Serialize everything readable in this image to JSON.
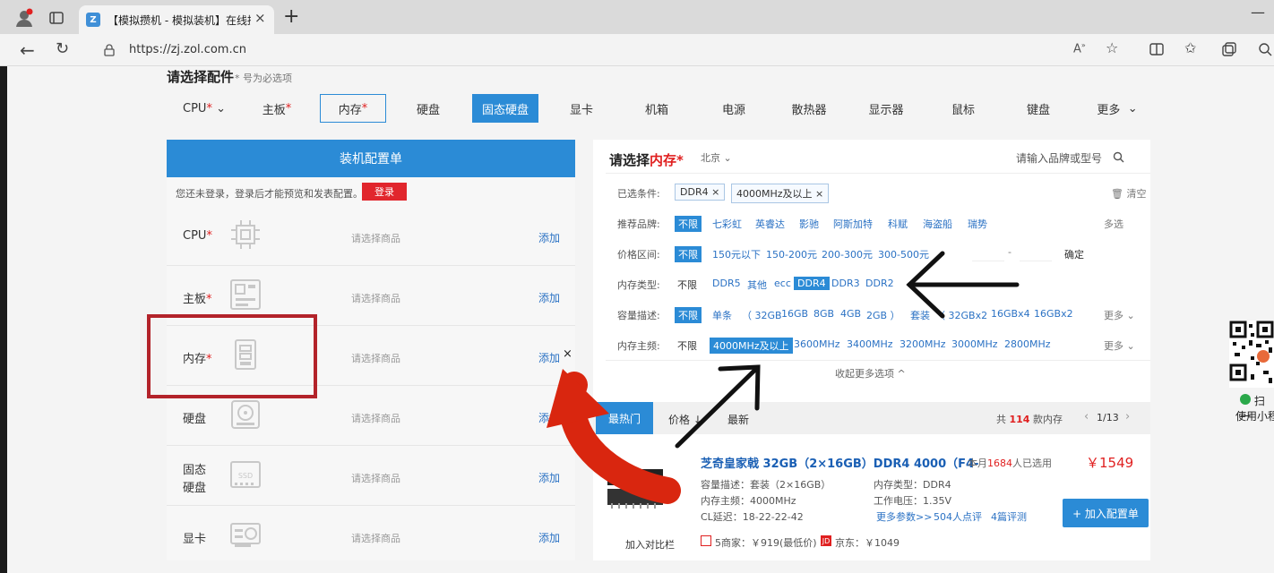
{
  "browser": {
    "tab_title": "【模拟攒机 - 模拟装机】在线攒",
    "tab_close": "×",
    "new_tab": "+",
    "url": "https://zj.zol.com.cn",
    "minimize": "—"
  },
  "header": {
    "title": "请选择配件",
    "required_note": "* 号为必选项"
  },
  "categories": [
    {
      "label": "CPU",
      "req": "*",
      "arrow": "⌄"
    },
    {
      "label": "主板",
      "req": "*"
    },
    {
      "label": "内存",
      "req": "*"
    },
    {
      "label": "硬盘"
    },
    {
      "label": "固态硬盘"
    },
    {
      "label": "显卡"
    },
    {
      "label": "机箱"
    },
    {
      "label": "电源"
    },
    {
      "label": "散热器"
    },
    {
      "label": "显示器"
    },
    {
      "label": "鼠标"
    },
    {
      "label": "键盘"
    },
    {
      "label": "更多",
      "arrow": "⌄"
    }
  ],
  "config": {
    "title": "装机配置单",
    "login_msg": "您还未登录，登录后才能预览和发表配置。",
    "login_btn": "登录",
    "hint": "请选择商品",
    "add": "添加",
    "remove": "×",
    "rows": [
      {
        "label": "CPU",
        "req": "*"
      },
      {
        "label": "主板",
        "req": "*"
      },
      {
        "label": "内存",
        "req": "*"
      },
      {
        "label": "硬盘"
      },
      {
        "label_line1": "固态",
        "label_line2": "硬盘"
      },
      {
        "label": "显卡"
      }
    ]
  },
  "filter": {
    "title_prefix": "请选择",
    "title_highlight": "内存",
    "title_req": "*",
    "city": "北京",
    "city_arrow": "⌄",
    "search_placeholder": "请输入品牌或型号",
    "selected_label": "已选条件:",
    "selected": [
      "DDR4 ×",
      "4000MHz及以上 ×"
    ],
    "clear": "清空",
    "brand_label": "推荐品牌:",
    "brand_all": "不限",
    "brands": [
      "七彩虹",
      "英睿达",
      "影驰",
      "阿斯加特",
      "科赋",
      "海盗船",
      "瑞势"
    ],
    "brand_more": "多选",
    "price_label": "价格区间:",
    "price_all": "不限",
    "prices": [
      "150元以下",
      "150-200元",
      "200-300元",
      "300-500元"
    ],
    "price_dash": "-",
    "price_ok": "确定",
    "type_label": "内存类型:",
    "type_all": "不限",
    "types_before": [
      "DDR5",
      "其他",
      "ecc"
    ],
    "type_selected": "DDR4",
    "types_after": [
      "DDR3",
      "DDR2"
    ],
    "cap_label": "容量描述:",
    "cap_all": "不限",
    "cap_items": [
      "单条",
      "（ 32GB",
      "16GB",
      "8GB",
      "4GB",
      "2GB ）",
      "套装",
      "（ 32GBx2",
      "16GBx4",
      "16GBx2"
    ],
    "cap_more": "更多",
    "freq_label": "内存主频:",
    "freq_all": "不限",
    "freq_selected": "4000MHz及以上",
    "freqs": [
      "3600MHz",
      "3400MHz",
      "3200MHz",
      "3000MHz",
      "2800MHz"
    ],
    "freq_more": "更多",
    "collapse": "收起更多选项 ^"
  },
  "sort": {
    "hot": "最热门",
    "price": "价格",
    "price_arrow": "↓",
    "newest": "最新",
    "total_prefix": "共",
    "total": "114",
    "total_suffix": "款内存",
    "prev": "‹",
    "page": "1/13",
    "next": "›"
  },
  "product": {
    "name": "芝奇皇家戟 32GB（2×16GB）DDR4 4000（F4-",
    "month_prefix": "本月",
    "month_count": "1684",
    "month_suffix": "人已选用",
    "price": "￥1549",
    "spec1": "容量描述：套装（2×16GB）",
    "spec2": "内存类型：DDR4",
    "spec3": "内存主频：4000MHz",
    "spec4": "工作电压：1.35V",
    "spec5": "CL延迟：18-22-22-42",
    "more_params": "更多参数>>",
    "reviews": "504人点评",
    "evals": "4篇评测",
    "add_btn": "+ 加入配置单",
    "compare": "加入对比栏",
    "shop1": "5商家：￥919(最低价)",
    "shop2": "京东：￥1049"
  },
  "qr": {
    "line1": "扫一",
    "line2": "使用小程"
  },
  "colors": {
    "accent": "#2b8bd6",
    "login_red": "#e1262d",
    "price_red": "#e02020",
    "highlight_box": "#b3232a",
    "arrow_red": "#d9260f"
  }
}
